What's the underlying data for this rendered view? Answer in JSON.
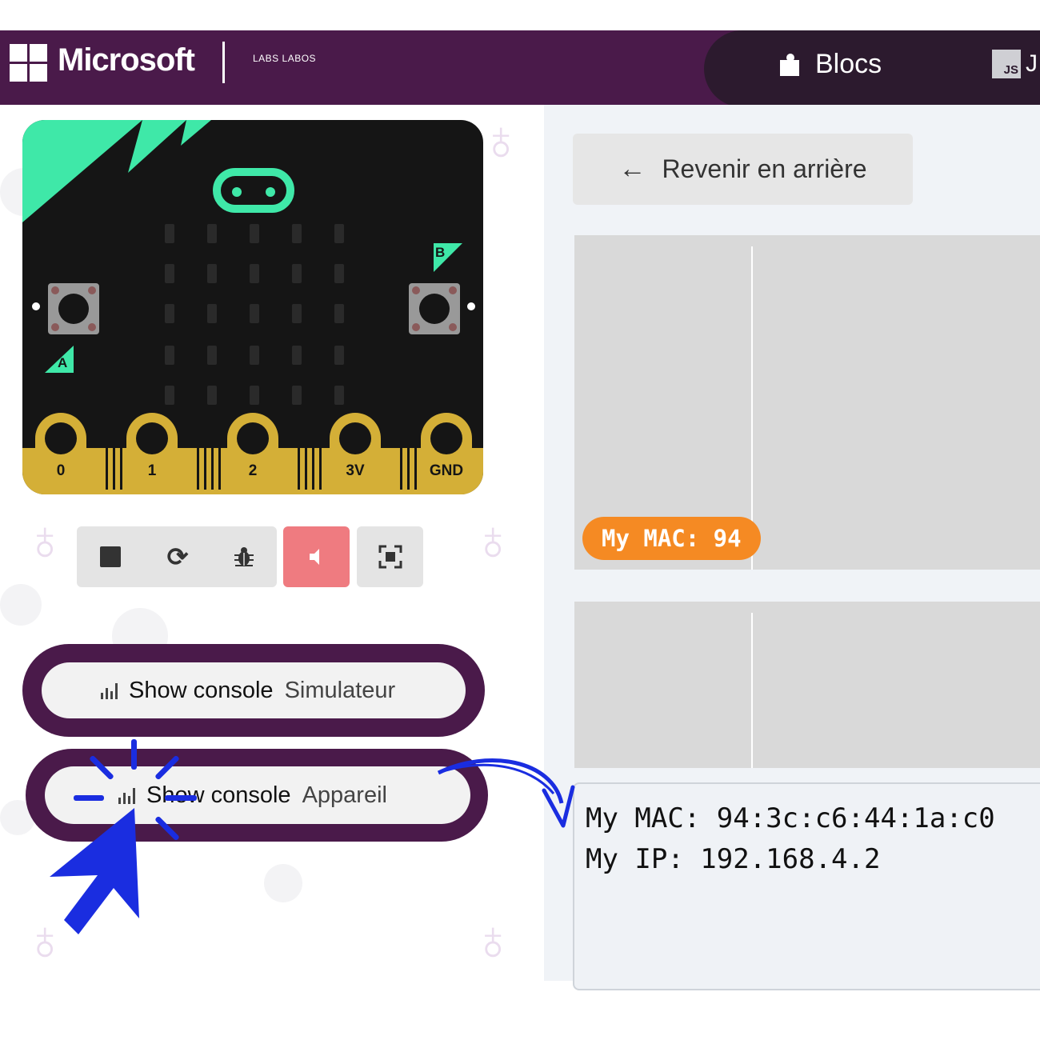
{
  "header": {
    "brand": "Microsoft",
    "partner_logo": "LABS LABOS",
    "tabs": [
      {
        "label": "Blocs",
        "icon": "puzzle-icon"
      },
      {
        "label": "J",
        "icon": "js-icon",
        "badge": "JS"
      }
    ]
  },
  "simulator": {
    "buttons": {
      "a": "A",
      "b": "B"
    },
    "pins": [
      "0",
      "1",
      "2",
      "3V",
      "GND"
    ],
    "toolbar": [
      {
        "name": "stop",
        "icon": "stop-icon"
      },
      {
        "name": "restart",
        "icon": "refresh-icon"
      },
      {
        "name": "debug",
        "icon": "bug-icon"
      },
      {
        "name": "mute",
        "icon": "speaker-icon"
      },
      {
        "name": "fullscreen",
        "icon": "fullscreen-icon"
      }
    ]
  },
  "console_buttons": {
    "simulator": {
      "label": "Show console",
      "sub": "Simulateur"
    },
    "device": {
      "label": "Show console",
      "sub": "Appareil"
    }
  },
  "editor": {
    "back_label": "Revenir en arrière",
    "badge": "My MAC: 94",
    "console_lines": [
      "My MAC: 94:3c:c6:44:1a:c0",
      "My IP: 192.168.4.2"
    ]
  },
  "colors": {
    "header": "#4a1a4a",
    "tab_pill": "#2c1a2e",
    "microbit_accent": "#3fe8a8",
    "gold": "#d4af37",
    "mute_active": "#ef7b80",
    "badge": "#f58a23",
    "annotation": "#1a2de0"
  }
}
